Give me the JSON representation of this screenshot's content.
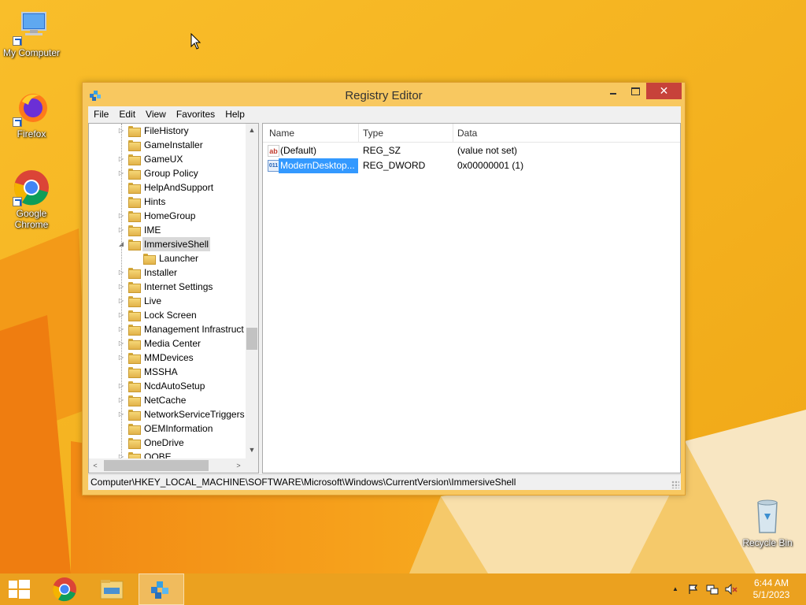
{
  "desktop": {
    "icons": [
      {
        "label": "My Computer"
      },
      {
        "label": "Firefox"
      },
      {
        "label": "Google Chrome"
      },
      {
        "label": "Recycle Bin"
      }
    ]
  },
  "window": {
    "title": "Registry Editor",
    "caption": {
      "close_glyph": "✕"
    },
    "menu": [
      "File",
      "Edit",
      "View",
      "Favorites",
      "Help"
    ],
    "tree": {
      "items": [
        {
          "label": "FileHistory",
          "expander": "▷",
          "level": 0
        },
        {
          "label": "GameInstaller",
          "expander": "",
          "level": 0
        },
        {
          "label": "GameUX",
          "expander": "▷",
          "level": 0
        },
        {
          "label": "Group Policy",
          "expander": "▷",
          "level": 0
        },
        {
          "label": "HelpAndSupport",
          "expander": "",
          "level": 0
        },
        {
          "label": "Hints",
          "expander": "",
          "level": 0
        },
        {
          "label": "HomeGroup",
          "expander": "▷",
          "level": 0
        },
        {
          "label": "IME",
          "expander": "▷",
          "level": 0
        },
        {
          "label": "ImmersiveShell",
          "expander": "◢",
          "level": 0,
          "selected": true
        },
        {
          "label": "Launcher",
          "expander": "",
          "level": 1
        },
        {
          "label": "Installer",
          "expander": "▷",
          "level": 0
        },
        {
          "label": "Internet Settings",
          "expander": "▷",
          "level": 0
        },
        {
          "label": "Live",
          "expander": "▷",
          "level": 0
        },
        {
          "label": "Lock Screen",
          "expander": "▷",
          "level": 0
        },
        {
          "label": "Management Infrastruct",
          "expander": "▷",
          "level": 0
        },
        {
          "label": "Media Center",
          "expander": "▷",
          "level": 0
        },
        {
          "label": "MMDevices",
          "expander": "▷",
          "level": 0
        },
        {
          "label": "MSSHA",
          "expander": "",
          "level": 0
        },
        {
          "label": "NcdAutoSetup",
          "expander": "▷",
          "level": 0
        },
        {
          "label": "NetCache",
          "expander": "▷",
          "level": 0
        },
        {
          "label": "NetworkServiceTriggers",
          "expander": "▷",
          "level": 0
        },
        {
          "label": "OEMInformation",
          "expander": "",
          "level": 0
        },
        {
          "label": "OneDrive",
          "expander": "",
          "level": 0
        },
        {
          "label": "OOBE",
          "expander": "▷",
          "level": 0
        }
      ],
      "scroll_up": "▲",
      "scroll_down": "▼",
      "scroll_left": "<",
      "scroll_right": ">"
    },
    "list": {
      "columns": [
        "Name",
        "Type",
        "Data"
      ],
      "rows": [
        {
          "icon": "ab",
          "name": "(Default)",
          "type": "REG_SZ",
          "data": "(value not set)",
          "selected": false
        },
        {
          "icon": "011",
          "name": "ModernDesktop...",
          "type": "REG_DWORD",
          "data": "0x00000001 (1)",
          "selected": true
        }
      ]
    },
    "status": "Computer\\HKEY_LOCAL_MACHINE\\SOFTWARE\\Microsoft\\Windows\\CurrentVersion\\ImmersiveShell"
  },
  "taskbar": {
    "clock_time": "6:44 AM",
    "clock_date": "5/1/2023",
    "tray_expand_glyph": "▲"
  }
}
